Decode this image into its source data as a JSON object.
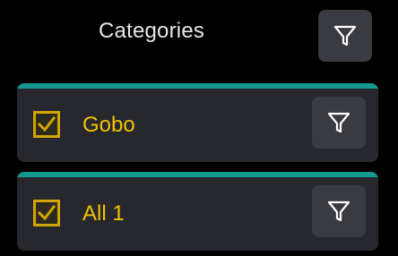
{
  "header": {
    "title": "Categories",
    "filter_icon": "filter-icon"
  },
  "items": [
    {
      "label": "Gobo",
      "checked": true,
      "filter_icon": "filter-icon"
    },
    {
      "label": "All 1",
      "checked": true,
      "filter_icon": "filter-icon"
    }
  ],
  "colors": {
    "background": "#000000",
    "card": "#27282d",
    "accent_bar": "#13998d",
    "checkbox_gold": "#d4a400",
    "label_gold": "#f2c200",
    "icon_button": "#3a3b41"
  }
}
